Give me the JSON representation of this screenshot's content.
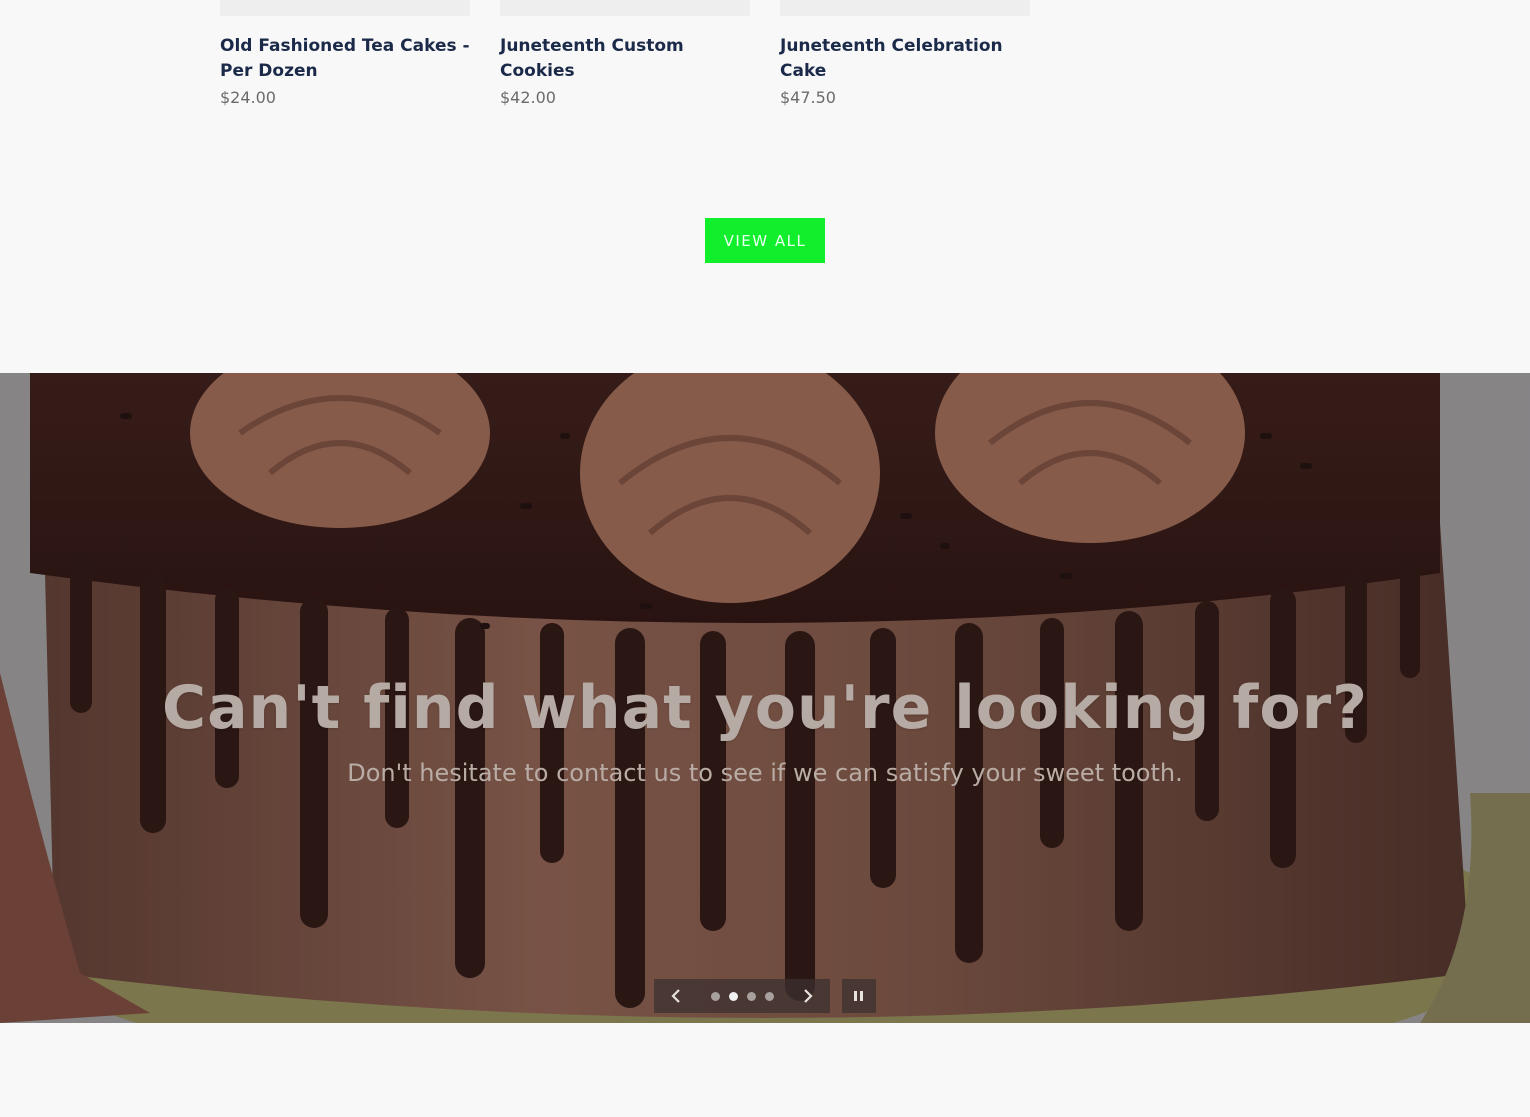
{
  "products": [
    {
      "title": "Old Fashioned Tea Cakes - Per Dozen",
      "price": "$24.00"
    },
    {
      "title": "Juneteenth Custom Cookies",
      "price": "$42.00"
    },
    {
      "title": "Juneteenth Celebration Cake",
      "price": "$47.50"
    }
  ],
  "view_all_label": "VIEW ALL",
  "hero": {
    "heading": "Can't find what you're looking for?",
    "subheading": "Don't hesitate to contact us to see if we can satisfy your sweet tooth.",
    "slide_count": 4,
    "active_slide": 2
  },
  "icons": {
    "prev": "chevron-left-icon",
    "next": "chevron-right-icon",
    "pause": "pause-icon"
  },
  "colors": {
    "accent": "#11ee2b",
    "product_title": "#1c2a4a",
    "price": "#6b6b6b"
  }
}
